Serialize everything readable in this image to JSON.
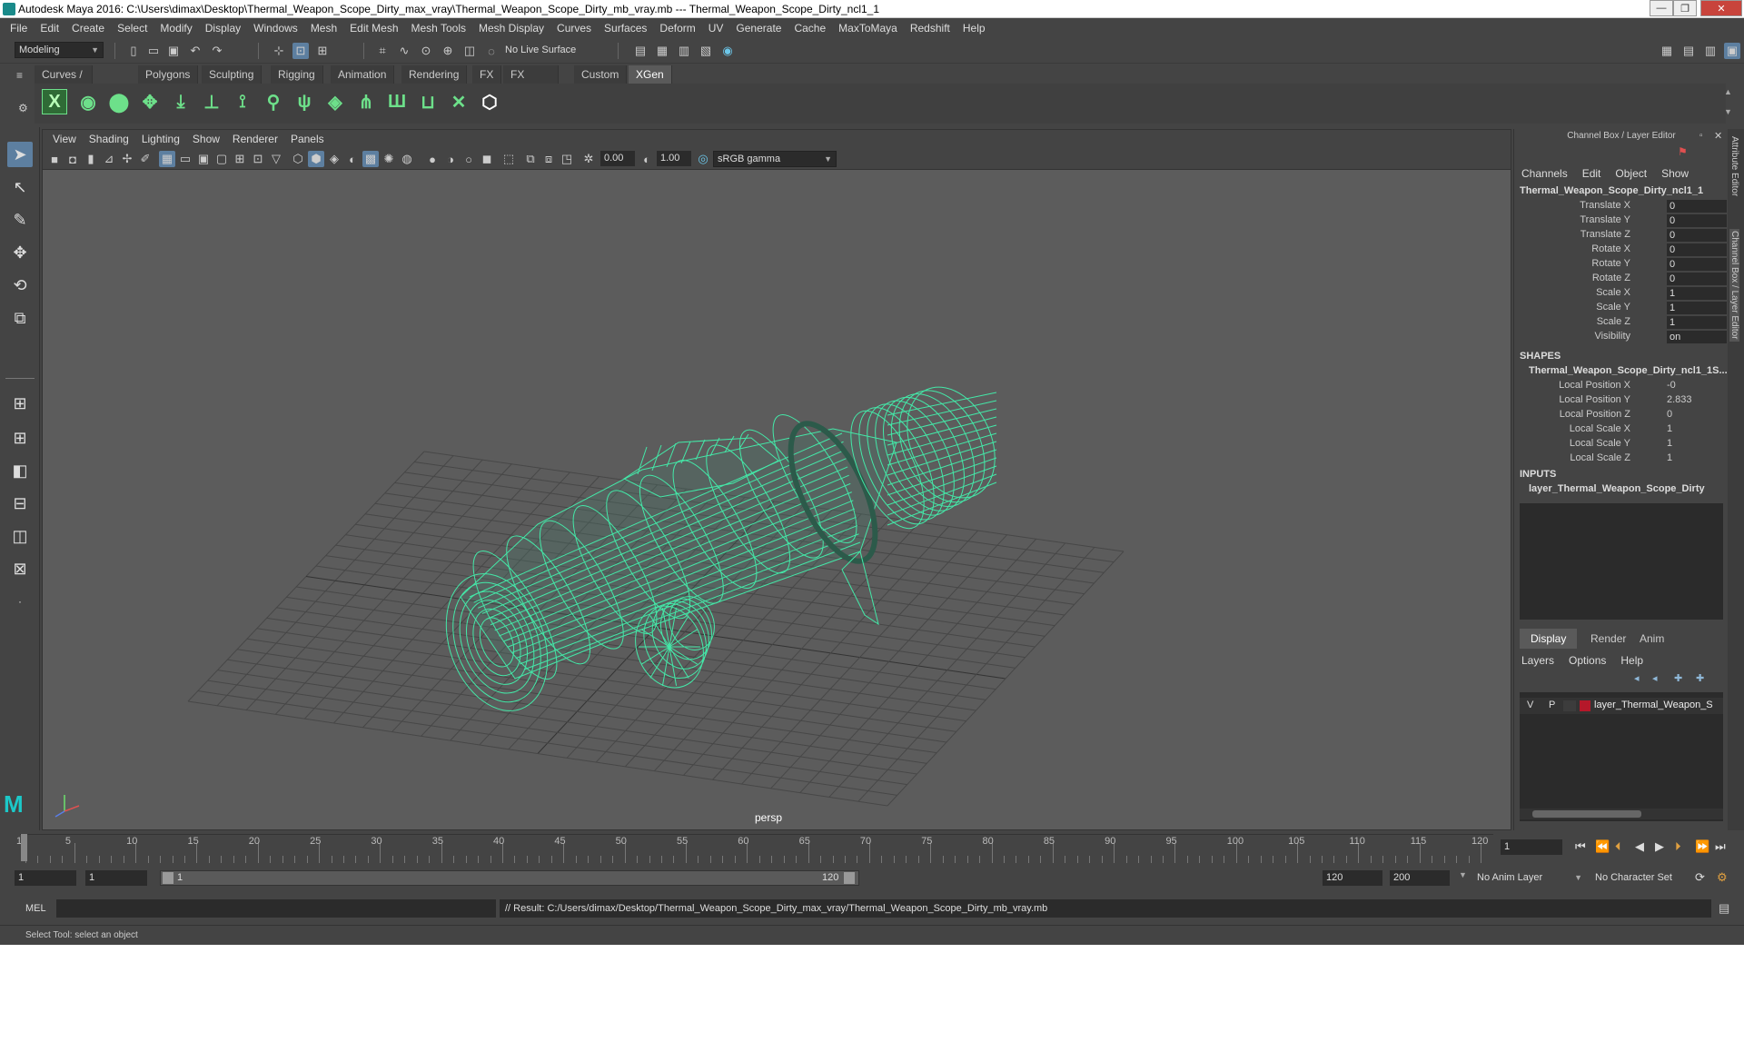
{
  "window": {
    "title": "Autodesk Maya 2016: C:\\Users\\dimax\\Desktop\\Thermal_Weapon_Scope_Dirty_max_vray\\Thermal_Weapon_Scope_Dirty_mb_vray.mb   ---   Thermal_Weapon_Scope_Dirty_ncl1_1",
    "minimize": "—",
    "maximize": "❐",
    "close": "✕"
  },
  "menubar": [
    "File",
    "Edit",
    "Create",
    "Select",
    "Modify",
    "Display",
    "Windows",
    "Mesh",
    "Edit Mesh",
    "Mesh Tools",
    "Mesh Display",
    "Curves",
    "Surfaces",
    "Deform",
    "UV",
    "Generate",
    "Cache",
    "MaxToMaya",
    "Redshift",
    "Help"
  ],
  "statusline": {
    "mode": "Modeling",
    "live_surface": "No Live Surface"
  },
  "shelf_tabs": [
    "Curves / Surfaces",
    "Polygons",
    "Sculpting",
    "Rigging",
    "Animation",
    "Rendering",
    "FX",
    "FX Caching",
    "Custom",
    "XGen"
  ],
  "shelf_active": "XGen",
  "viewport": {
    "menu": [
      "View",
      "Shading",
      "Lighting",
      "Show",
      "Renderer",
      "Panels"
    ],
    "exposure": "0.00",
    "gamma": "1.00",
    "color_space": "sRGB gamma",
    "camera_label": "persp"
  },
  "channel_box": {
    "title": "Channel Box / Layer Editor",
    "menu": [
      "Channels",
      "Edit",
      "Object",
      "Show"
    ],
    "object_name": "Thermal_Weapon_Scope_Dirty_ncl1_1",
    "attributes": [
      {
        "label": "Translate X",
        "value": "0"
      },
      {
        "label": "Translate Y",
        "value": "0"
      },
      {
        "label": "Translate Z",
        "value": "0"
      },
      {
        "label": "Rotate X",
        "value": "0"
      },
      {
        "label": "Rotate Y",
        "value": "0"
      },
      {
        "label": "Rotate Z",
        "value": "0"
      },
      {
        "label": "Scale X",
        "value": "1"
      },
      {
        "label": "Scale Y",
        "value": "1"
      },
      {
        "label": "Scale Z",
        "value": "1"
      },
      {
        "label": "Visibility",
        "value": "on"
      }
    ],
    "shapes_heading": "SHAPES",
    "shape_name": "Thermal_Weapon_Scope_Dirty_ncl1_1S...",
    "shape_attributes": [
      {
        "label": "Local Position X",
        "value": "-0"
      },
      {
        "label": "Local Position Y",
        "value": "2.833"
      },
      {
        "label": "Local Position Z",
        "value": "0"
      },
      {
        "label": "Local Scale X",
        "value": "1"
      },
      {
        "label": "Local Scale Y",
        "value": "1"
      },
      {
        "label": "Local Scale Z",
        "value": "1"
      }
    ],
    "inputs_heading": "INPUTS",
    "input_name": "layer_Thermal_Weapon_Scope_Dirty"
  },
  "layer_editor": {
    "tabs": [
      "Display",
      "Render",
      "Anim"
    ],
    "active_tab": "Display",
    "menu": [
      "Layers",
      "Options",
      "Help"
    ],
    "layer": {
      "v": "V",
      "p": "P",
      "name": "layer_Thermal_Weapon_S",
      "color": "#b5182a"
    }
  },
  "side_tabs": [
    "Attribute Editor",
    "Channel Box / Layer Editor"
  ],
  "timeline": {
    "ticks": [
      "1",
      "5",
      "10",
      "15",
      "20",
      "25",
      "30",
      "35",
      "40",
      "45",
      "50",
      "55",
      "60",
      "65",
      "70",
      "75",
      "80",
      "85",
      "90",
      "95",
      "100",
      "105",
      "110",
      "115",
      "120"
    ],
    "current_frame": "1"
  },
  "range": {
    "start": "1",
    "playback_start": "1",
    "slider_start": "1",
    "slider_end": "120",
    "playback_end": "120",
    "end": "200",
    "anim_layer": "No Anim Layer",
    "character_set": "No Character Set"
  },
  "command": {
    "lang": "MEL",
    "result": "// Result: C:/Users/dimax/Desktop/Thermal_Weapon_Scope_Dirty_max_vray/Thermal_Weapon_Scope_Dirty_mb_vray.mb"
  },
  "help_line": "Select Tool: select an object",
  "colors": {
    "wireframe": "#44e8a8",
    "accent": "#5d7fa0",
    "background": "#444444",
    "viewport": "#5c5c5c"
  }
}
